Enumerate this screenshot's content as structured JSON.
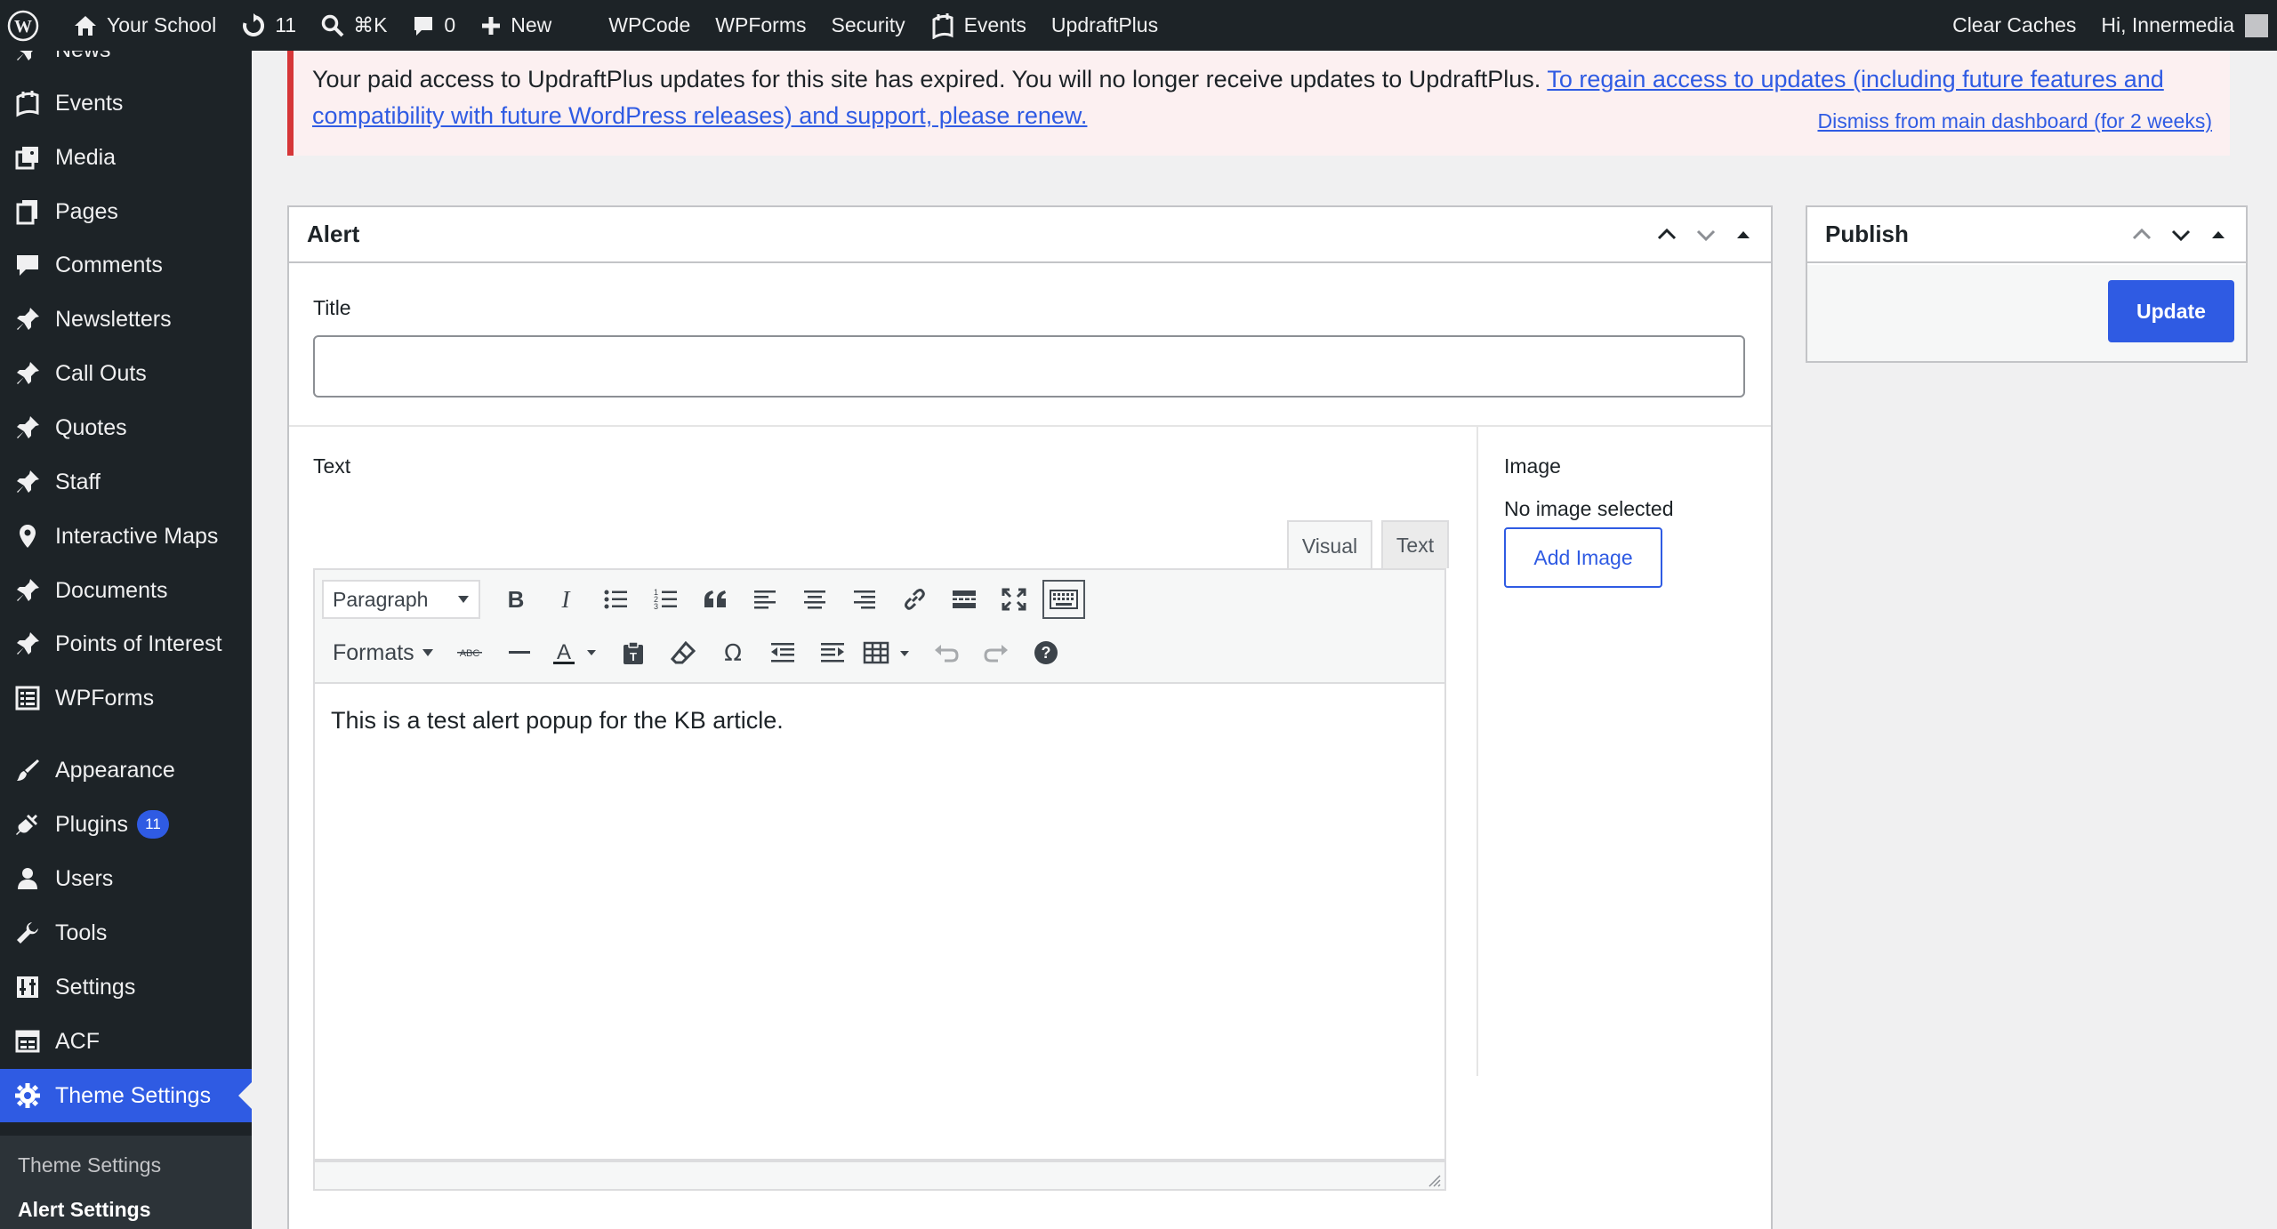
{
  "admin_bar": {
    "site_name": "Your School",
    "updates_count": "11",
    "search_shortcut": "⌘K",
    "comments_count": "0",
    "new_label": "New",
    "links": [
      "WPCode",
      "WPForms",
      "Security",
      "Events",
      "UpdraftPlus"
    ],
    "clear_caches": "Clear Caches",
    "greeting": "Hi, Innermedia"
  },
  "sidebar": {
    "items": [
      {
        "label": "News",
        "icon": "pin-icon"
      },
      {
        "label": "Events",
        "icon": "events-icon"
      },
      {
        "label": "Media",
        "icon": "media-icon"
      },
      {
        "label": "Pages",
        "icon": "pages-icon"
      },
      {
        "label": "Comments",
        "icon": "comment-icon"
      },
      {
        "label": "Newsletters",
        "icon": "pin-icon"
      },
      {
        "label": "Call Outs",
        "icon": "pin-icon"
      },
      {
        "label": "Quotes",
        "icon": "pin-icon"
      },
      {
        "label": "Staff",
        "icon": "pin-icon"
      },
      {
        "label": "Interactive Maps",
        "icon": "location-icon"
      },
      {
        "label": "Documents",
        "icon": "pin-icon"
      },
      {
        "label": "Points of Interest",
        "icon": "pin-icon"
      },
      {
        "label": "WPForms",
        "icon": "form-icon"
      },
      {
        "label": "Appearance",
        "icon": "brush-icon"
      },
      {
        "label": "Plugins",
        "icon": "plugin-icon",
        "badge": "11"
      },
      {
        "label": "Users",
        "icon": "user-icon"
      },
      {
        "label": "Tools",
        "icon": "wrench-icon"
      },
      {
        "label": "Settings",
        "icon": "settings-icon"
      },
      {
        "label": "ACF",
        "icon": "acf-icon"
      },
      {
        "label": "Theme Settings",
        "icon": "gear-icon"
      }
    ],
    "submenu": [
      "Theme Settings",
      "Alert Settings"
    ]
  },
  "notice": {
    "text": "Your paid access to UpdraftPlus updates for this site has expired. You will no longer receive updates to UpdraftPlus.",
    "link": "To regain access to updates (including future features and compatibility with future WordPress releases) and support, please renew.",
    "dismiss": "Dismiss from main dashboard (for 2 weeks)"
  },
  "alert_box": {
    "title": "Alert",
    "title_label": "Title",
    "title_value": "",
    "text_label": "Text",
    "tabs": [
      "Visual",
      "Text"
    ],
    "format_select": "Paragraph",
    "formats_label": "Formats",
    "content": "This is a test alert popup for the KB article.",
    "image_label": "Image",
    "no_image": "No image selected",
    "add_image": "Add Image"
  },
  "publish_box": {
    "title": "Publish",
    "update_label": "Update"
  },
  "colors": {
    "admin_bg": "#1d2327",
    "accent": "#2f5be3",
    "notice_border": "#d63638",
    "notice_bg": "#fcf0f1"
  }
}
